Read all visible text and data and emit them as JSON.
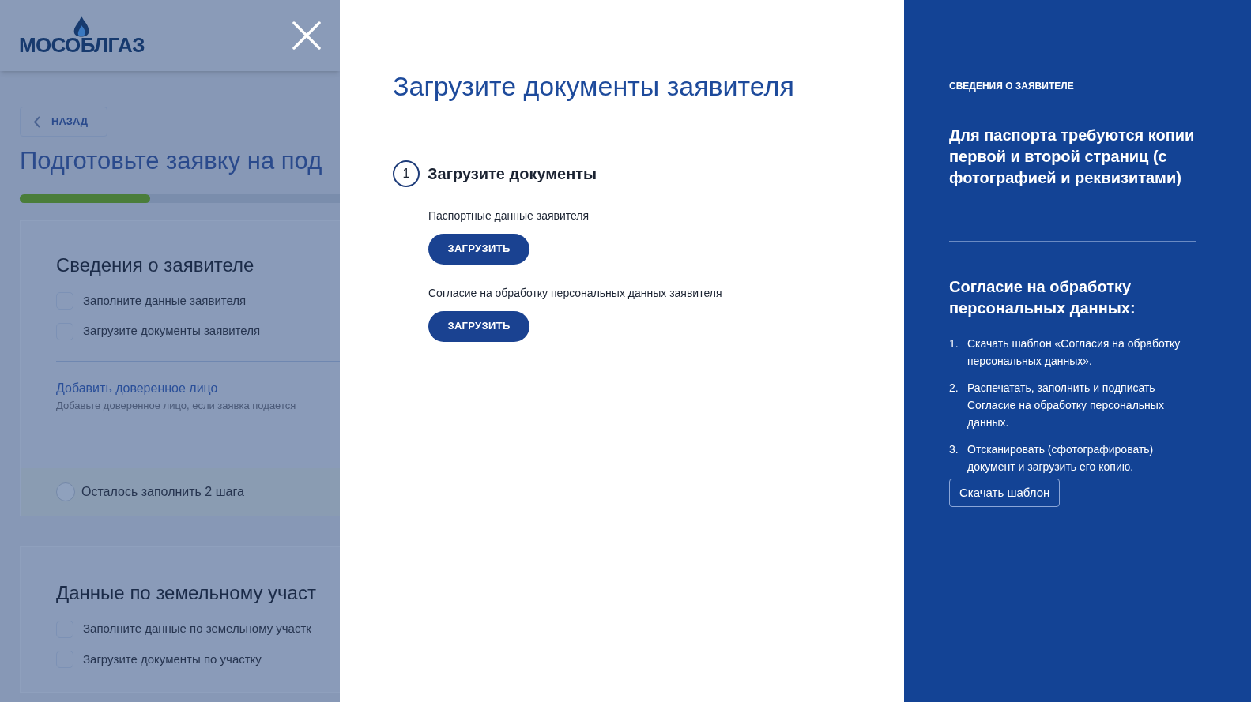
{
  "background_page": {
    "logo": "МОСОБЛГАЗ",
    "back_button": "НАЗАД",
    "title": "Подготовьте заявку на под",
    "progress": {
      "level": 0.33
    },
    "sections": [
      {
        "title": "Сведения о заявителе",
        "tasks": [
          {
            "label": "Заполните данные заявителя",
            "checked": false
          },
          {
            "label": "Загрузите документы заявителя",
            "checked": false
          }
        ],
        "link": "Добавить доверенное лицо",
        "hint": "Добавьте доверенное лицо, если заявка подается",
        "footer": "Осталось заполнить 2 шага"
      },
      {
        "title": "Данные по земельному участ",
        "tasks": [
          {
            "label": "Заполните данные по земельному участк",
            "checked": false
          },
          {
            "label": "Загрузите документы по участку",
            "checked": false
          }
        ]
      }
    ]
  },
  "modal": {
    "title": "Загрузите документы заявителя",
    "step": {
      "number": "1",
      "title": "Загрузите документы"
    },
    "uploads": [
      {
        "label": "Паспортные данные заявителя",
        "button": "ЗАГРУЗИТЬ"
      },
      {
        "label": "Согласие на обработку персональных данных заявителя",
        "button": "ЗАГРУЗИТЬ"
      }
    ]
  },
  "info_panel": {
    "eyebrow": "СВЕДЕНИЯ О ЗАЯВИТЕЛЕ",
    "passport_note": "Для паспорта требуются копии первой и второй страниц (с фотографией и реквизитами)",
    "consent_title": "Согласие на обработку персональных данных:",
    "steps": [
      {
        "number": "1.",
        "text": "Скачать шаблон «Согласия на обработку персональных данных»."
      },
      {
        "number": "2.",
        "text": "Распечатать, заполнить и подписать Согласие на обработку персональных данных."
      },
      {
        "number": "3.",
        "text": "Отсканировать (сфотографировать) документ и загрузить его копию."
      }
    ],
    "download_button": "Скачать шаблон"
  }
}
